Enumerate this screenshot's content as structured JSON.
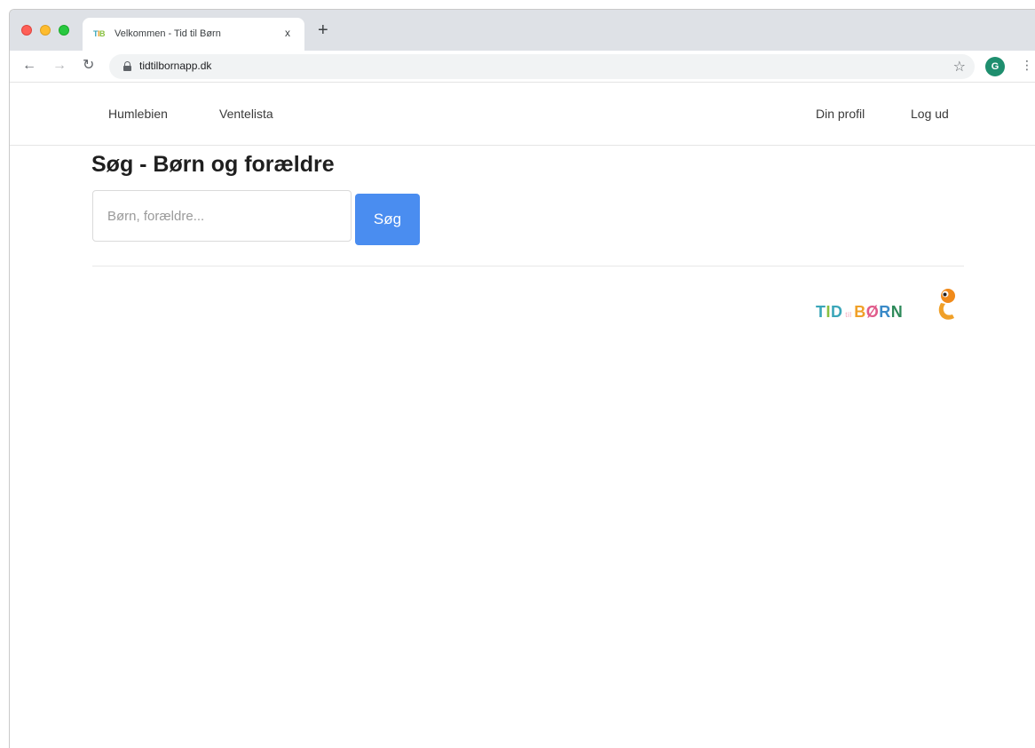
{
  "browser": {
    "tab_title": "Velkommen - Tid til Børn",
    "tab_close": "x",
    "new_tab": "+",
    "url": "tidtilbornapp.dk",
    "profile_initial": "G",
    "icons": [
      "back-icon",
      "forward-icon",
      "reload-icon",
      "lock-icon",
      "star-icon",
      "menu-icon"
    ]
  },
  "navbar": {
    "left_links": [
      "Humlebien",
      "Ventelista"
    ],
    "right_links": [
      "Din profil",
      "Log ud"
    ]
  },
  "page": {
    "title": "Søg - Børn og forældre",
    "search": {
      "placeholder": "Børn, forældre...",
      "value": "",
      "button_label": "Søg"
    }
  },
  "logo": {
    "parts": [
      "TID",
      "TIL",
      "BØRN"
    ],
    "colors": {
      "T": "#3aa6b9",
      "I": "#8ac040",
      "D": "#3aa6b9",
      "til": "#f2a2b6",
      "B": "#f0a028",
      "Ø": "#e05a8a",
      "R": "#3a8ac8",
      "N": "#2e8a5a",
      "bird": "#f08a1a"
    }
  },
  "colors": {
    "accent": "#4a8df0",
    "titlebar": "#dee1e6",
    "text": "#1f1f1f"
  }
}
